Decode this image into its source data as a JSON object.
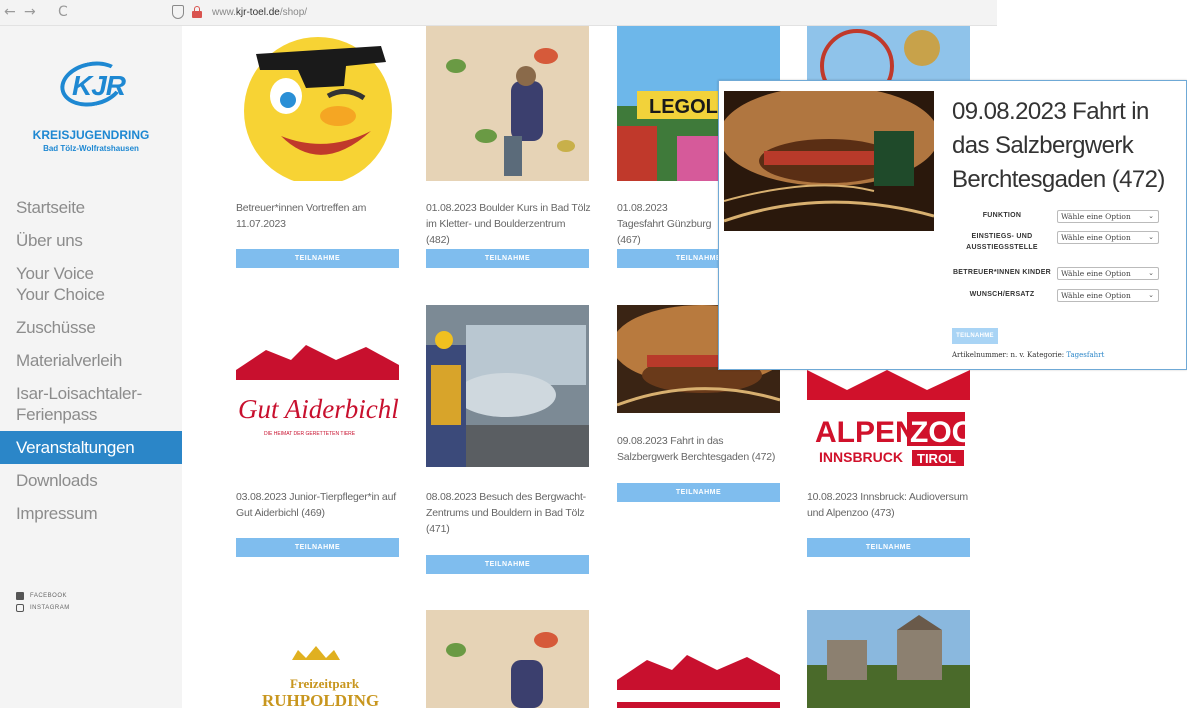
{
  "browser": {
    "back": "←",
    "forward": "→",
    "reload": "C",
    "url_prefix": "www.",
    "url_domain": "kjr-toel.de",
    "url_path": "/shop/"
  },
  "logo": {
    "letters": "KJR",
    "title": "KREISJUGENDRING",
    "subtitle": "Bad Tölz-Wolfratshausen"
  },
  "menu": [
    {
      "label": "Startseite"
    },
    {
      "label": "Über uns"
    },
    {
      "label": "Your Voice Your Choice"
    },
    {
      "label": "Zuschüsse"
    },
    {
      "label": "Materialverleih"
    },
    {
      "label": "Isar-Loisachtaler-Ferienpass"
    },
    {
      "label": "Veranstaltungen",
      "active": true
    },
    {
      "label": "Downloads"
    },
    {
      "label": "Impressum"
    }
  ],
  "social": {
    "facebook": "FACEBOOK",
    "instagram": "INSTAGRAM"
  },
  "cards": [
    {
      "title": "Betreuer*innen Vortreffen am 11.07.2023",
      "button": "TEILNAHME"
    },
    {
      "title": "01.08.2023 Boulder Kurs in Bad Tölz im Kletter- und Boulderzentrum (482)",
      "button": "TEILNAHME"
    },
    {
      "title": "01.08.2023 Tagesfahrt Günzburg (467)",
      "button": "TEILNAHME"
    },
    {
      "title": "03.08.2023 Junior-Tierpfleger*in auf Gut Aiderbichl (469)",
      "button": "TEILNAHME"
    },
    {
      "title": "08.08.2023 Besuch des Bergwacht-Zentrums und Bouldern in Bad Tölz (471)",
      "button": "TEILNAHME"
    },
    {
      "title": "09.08.2023 Fahrt in das Salzbergwerk Berchtesgaden (472)",
      "button": "TEILNAHME"
    },
    {
      "title": "10.08.2023 Innsbruck: Audioversum und Alpenzoo (473)",
      "button": "TEILNAHME"
    }
  ],
  "thumb_text": {
    "legoland": "LEGOLA",
    "aiderbichl": "Gut Aiderbichl",
    "aiderbichl_tag": "DIE HEIMAT DER GERETTETEN TIERE",
    "alpenzoo_1": "ALPEN",
    "alpenzoo_2": "ZOO",
    "alpenzoo_3": "INNSBRUCK",
    "alpenzoo_4": "TIROL",
    "ruhpolding_1": "Freizeitpark",
    "ruhpolding_2": "RUHPOLDING"
  },
  "popup": {
    "title": "09.08.2023 Fahrt in das Salzbergwerk Berchtesgaden (472)",
    "options": [
      {
        "label": "FUNKTION",
        "value": "Wähle eine Option"
      },
      {
        "label": "EINSTIEGS- UND AUSSTIEGSSTELLE",
        "value": "Wähle eine Option"
      },
      {
        "label": "BETREUER*INNEN KINDER",
        "value": "Wähle eine Option"
      },
      {
        "label": "WUNSCH/ERSATZ",
        "value": "Wähle eine Option"
      }
    ],
    "button": "TEILNAHME",
    "meta_prefix": "Artikelnummer: n. v. Kategorie:",
    "category": "Tagesfahrt"
  },
  "colors": {
    "accent": "#2b86c8",
    "button": "#7fbdee"
  }
}
